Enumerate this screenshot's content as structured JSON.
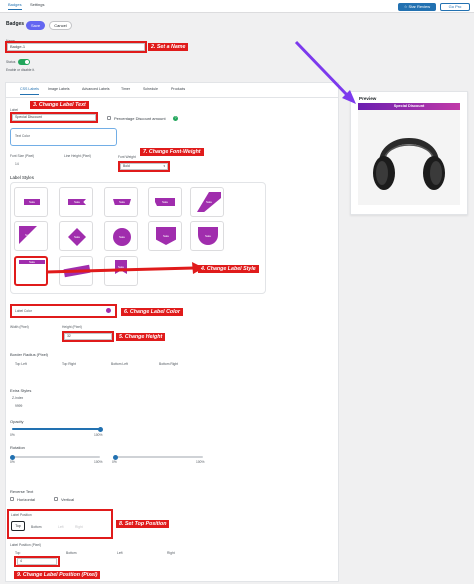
{
  "topnav": {
    "tab_badges": "Badges",
    "tab_settings": "Settings",
    "star_review": "☆ Star Review",
    "go_pro": "Go Pro"
  },
  "page": {
    "title": "Badges",
    "save": "Save",
    "cancel": "Cancel"
  },
  "name_field": {
    "label": "Name",
    "value": "Badge-1"
  },
  "status": {
    "label": "Status",
    "help": "Enable or disable it."
  },
  "tabs": [
    "CSS Labels",
    "Image Labels",
    "Advanced Labels",
    "Timer",
    "Schedule",
    "Products"
  ],
  "label_text": {
    "label": "Label",
    "value": "Special Discount",
    "pct_label": "Percentage Discount amount",
    "info_icon": "?"
  },
  "text_color": {
    "label": "Text Color"
  },
  "font": {
    "size_label": "Font Size (Pixel)",
    "size_value": "14",
    "line_label": "Line Height (Pixel)",
    "weight_label": "Font Weight",
    "weight_value": "Bold"
  },
  "label_styles": {
    "title": "Label Styles",
    "sample_text": "Sale"
  },
  "label_color": {
    "label": "Label Color",
    "color": "#a02dad"
  },
  "dimensions": {
    "width_label": "Width (Pixel)",
    "height_label": "Height (Pixel)",
    "height_value": "32"
  },
  "border_radius": {
    "title": "Border Radius (Pixel)",
    "top_left": "Top Left",
    "top_right": "Top Right",
    "bottom_left": "Bottom Left",
    "bottom_right": "Bottom Right"
  },
  "extra_styles": {
    "title": "Extra Styles",
    "zindex_label": "Z-Index",
    "zindex_value": "9999"
  },
  "opacity": {
    "label": "Opacity",
    "min": "0%",
    "max": "100%",
    "value_pct": 100
  },
  "rotation": {
    "label": "Rotation",
    "x_min": "0%",
    "x_max": "100%",
    "y_min": "0%",
    "y_max": "100%"
  },
  "reverse_text": {
    "label": "Reverse Text",
    "horizontal": "Horizontal",
    "vertical": "Vertical"
  },
  "label_position": {
    "title": "Label Position",
    "options": [
      "Top",
      "Bottom",
      "Left",
      "Right"
    ],
    "pixel_title": "Label Position (Pixel)",
    "top_label": "Top",
    "bottom_label": "Bottom",
    "left_label": "Left",
    "right_label": "Right",
    "top_value": "4"
  },
  "preview": {
    "title": "Preview",
    "badge_text": "Special Discount"
  },
  "annotations": {
    "a2": "2. Set a Name",
    "a3": "3. Change Label Text",
    "a7": "7. Change Font-Weight",
    "a4": "4. Change Label Style",
    "a6": "6. Change Label Color",
    "a5": "5. Change Height",
    "a8": "8. Set Top Position",
    "a9": "9. Change Label Position (Pixel)"
  },
  "colors": {
    "accent": "#2271b1",
    "purple": "#a02dad",
    "annotation_red": "#e01b1b",
    "arrow_violet": "#7c3aed"
  }
}
